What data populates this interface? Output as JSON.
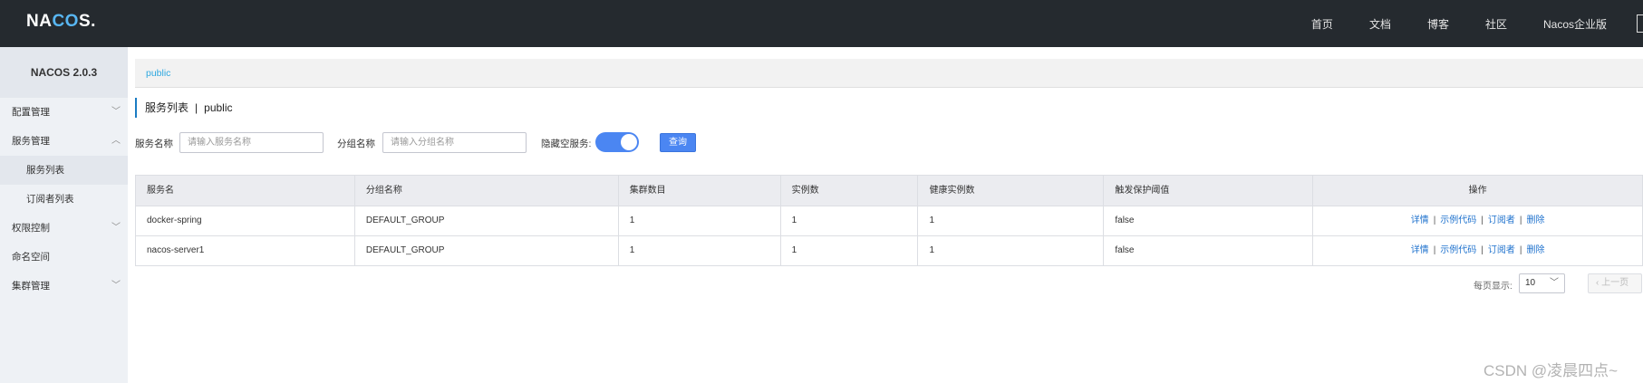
{
  "header": {
    "logo_prefix": "NA",
    "logo_accent": "CO",
    "logo_suffix": "S.",
    "nav": [
      "首页",
      "文档",
      "博客",
      "社区",
      "Nacos企业版"
    ]
  },
  "sidebar": {
    "title": "NACOS 2.0.3",
    "items": [
      {
        "label": "配置管理",
        "chevron": "⌄"
      },
      {
        "label": "服务管理",
        "chevron": "⌃"
      },
      {
        "label": "服务列表"
      },
      {
        "label": "订阅者列表"
      },
      {
        "label": "权限控制",
        "chevron": "⌄"
      },
      {
        "label": "命名空间"
      },
      {
        "label": "集群管理",
        "chevron": "⌄"
      }
    ]
  },
  "breadcrumb": "public",
  "page": {
    "title": "服务列表",
    "separator": "|",
    "namespace": "public"
  },
  "filters": {
    "service_label": "服务名称",
    "service_placeholder": "请输入服务名称",
    "group_label": "分组名称",
    "group_placeholder": "请输入分组名称",
    "hide_empty_label": "隐藏空服务:",
    "hide_empty_on": true,
    "query_label": "查询"
  },
  "table": {
    "headers": [
      "服务名",
      "分组名称",
      "集群数目",
      "实例数",
      "健康实例数",
      "触发保护阈值",
      "操作"
    ],
    "rows": [
      [
        "docker-spring",
        "DEFAULT_GROUP",
        "1",
        "1",
        "1",
        "false"
      ],
      [
        "nacos-server1",
        "DEFAULT_GROUP",
        "1",
        "1",
        "1",
        "false"
      ]
    ],
    "actions": [
      "详情",
      "示例代码",
      "订阅者",
      "删除"
    ]
  },
  "pagination": {
    "page_size_label": "每页显示:",
    "page_size": "10",
    "prev_label": "上一页"
  },
  "watermark": "CSDN @凌晨四点~",
  "colors": {
    "topbar": "#252a2f",
    "accent": "#4b86f2",
    "link": "#2073ce"
  }
}
